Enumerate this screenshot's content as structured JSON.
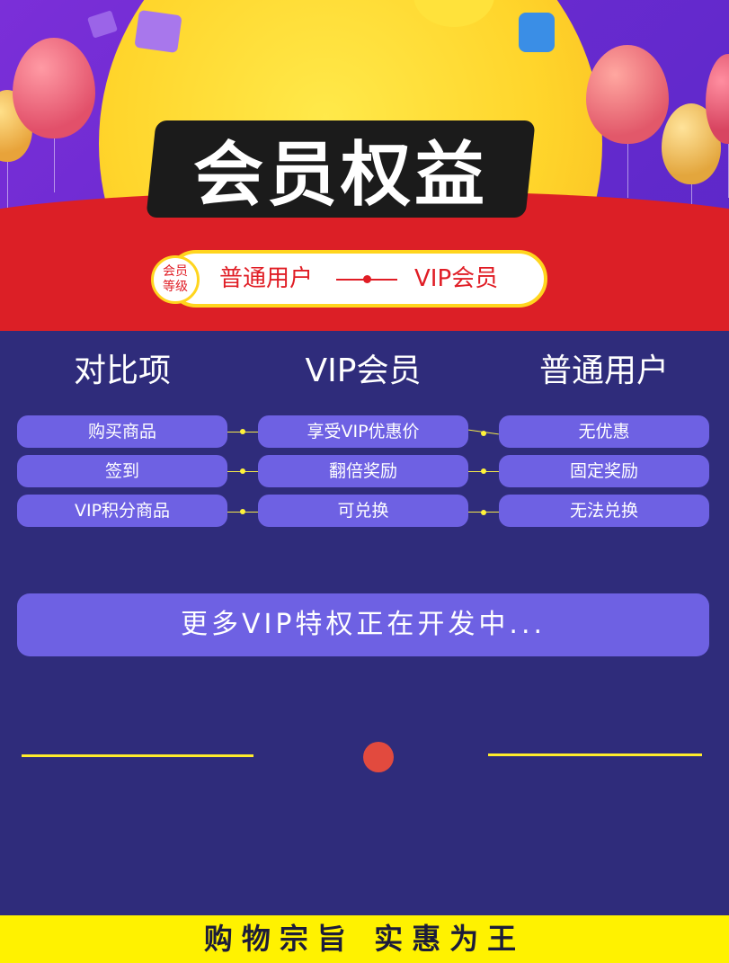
{
  "hero": {
    "title": "会员权益",
    "level_badge_top": "会员",
    "level_badge_bottom": "等级",
    "level_left": "普通用户",
    "level_right": "VIP会员"
  },
  "comparison": {
    "headers": [
      "对比项",
      "VIP会员",
      "普通用户"
    ],
    "rows": [
      [
        "购买商品",
        "享受VIP优惠价",
        "无优惠"
      ],
      [
        "签到",
        "翻倍奖励",
        "固定奖励"
      ],
      [
        "VIP积分商品",
        "可兑换",
        "无法兑换"
      ]
    ]
  },
  "more_button": "更多VIP特权正在开发中...",
  "footer": "购物宗旨 实惠为王",
  "colors": {
    "background": "#2f2c7b",
    "cell": "#6e61e3",
    "accent_red": "#dc1f26",
    "accent_yellow": "#fff200"
  }
}
